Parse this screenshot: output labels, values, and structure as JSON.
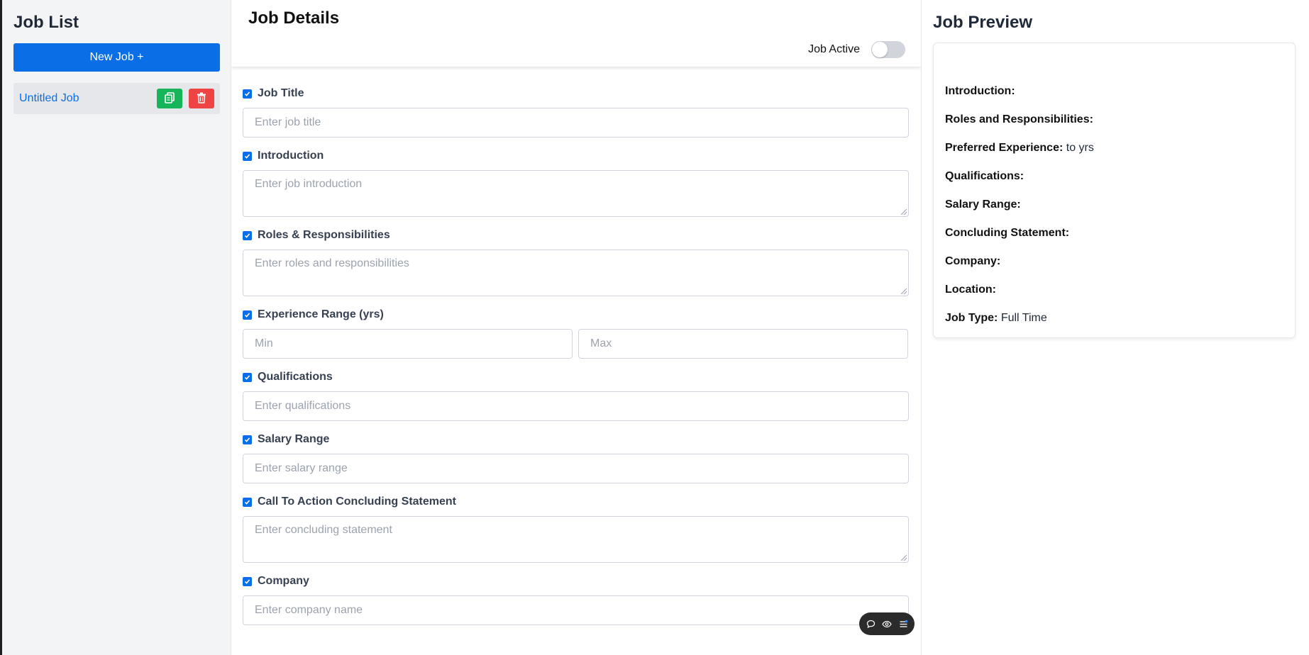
{
  "sidebar": {
    "title": "Job List",
    "new_job_label": "New Job +",
    "jobs": [
      {
        "name": "Untitled Job"
      }
    ]
  },
  "details": {
    "title": "Job Details",
    "active_label": "Job Active",
    "active": false,
    "fields": {
      "job_title": {
        "label": "Job Title",
        "placeholder": "Enter job title"
      },
      "introduction": {
        "label": "Introduction",
        "placeholder": "Enter job introduction"
      },
      "roles": {
        "label": "Roles & Responsibilities",
        "placeholder": "Enter roles and responsibilities"
      },
      "experience": {
        "label": "Experience Range (yrs)",
        "min_placeholder": "Min",
        "max_placeholder": "Max"
      },
      "qualifications": {
        "label": "Qualifications",
        "placeholder": "Enter qualifications"
      },
      "salary": {
        "label": "Salary Range",
        "placeholder": "Enter salary range"
      },
      "concluding": {
        "label": "Call To Action Concluding Statement",
        "placeholder": "Enter concluding statement"
      },
      "company": {
        "label": "Company",
        "placeholder": "Enter company name"
      }
    }
  },
  "preview": {
    "title": "Job Preview",
    "rows": {
      "introduction": {
        "label": "Introduction:",
        "value": ""
      },
      "roles": {
        "label": "Roles and Responsibilities:",
        "value": ""
      },
      "experience": {
        "label": "Preferred Experience:",
        "value": "to yrs"
      },
      "qualifications": {
        "label": "Qualifications:",
        "value": ""
      },
      "salary": {
        "label": "Salary Range:",
        "value": ""
      },
      "concluding": {
        "label": "Concluding Statement:",
        "value": ""
      },
      "company": {
        "label": "Company:",
        "value": ""
      },
      "location": {
        "label": "Location:",
        "value": ""
      },
      "job_type": {
        "label": "Job Type:",
        "value": "Full Time"
      }
    }
  },
  "colors": {
    "primary": "#0a6fe6",
    "copy_button": "#16b55a",
    "delete_button": "#ef4444"
  },
  "icons": [
    "copy-icon",
    "trash-icon",
    "chat-icon",
    "eye-icon",
    "menu-icon"
  ]
}
